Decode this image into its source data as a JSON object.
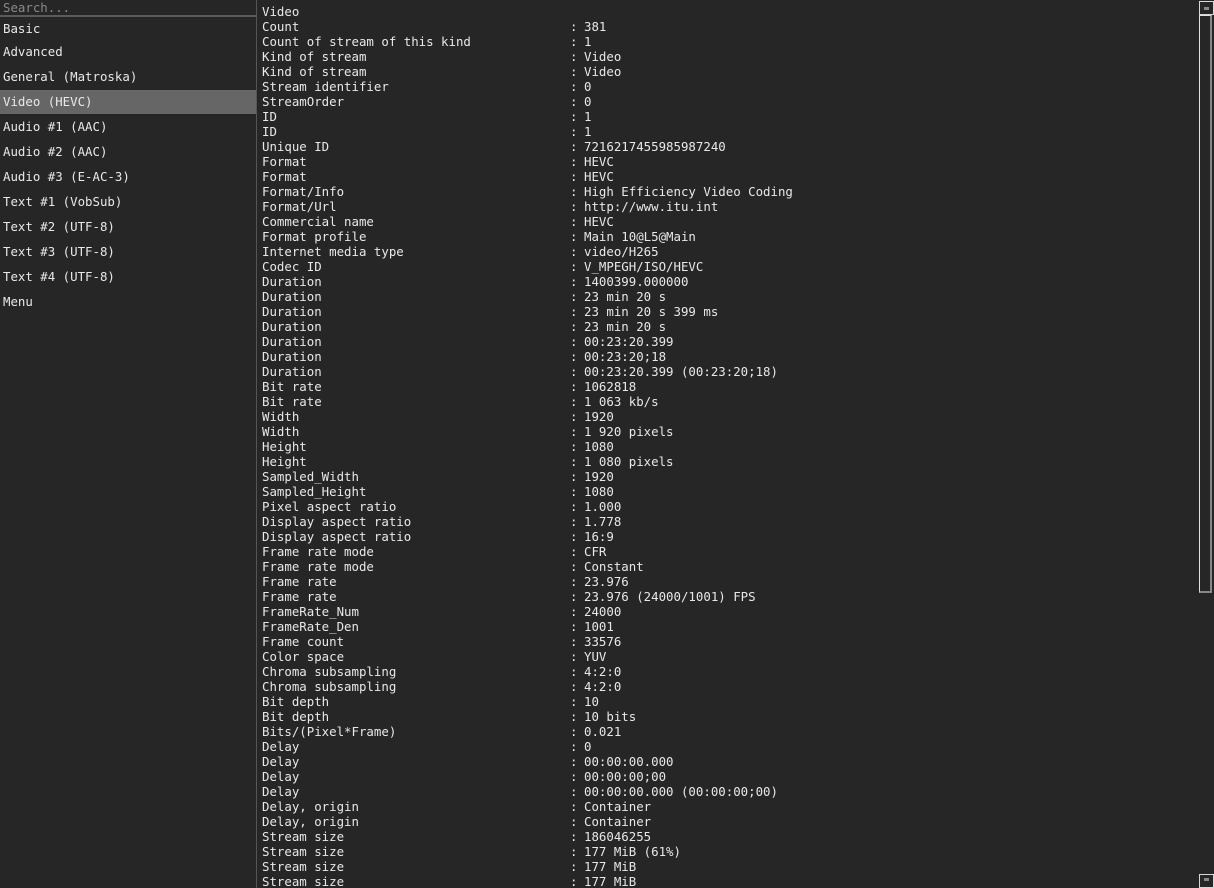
{
  "sidebar": {
    "search_placeholder": "Search...",
    "items": [
      {
        "label": "Basic",
        "selected": false
      },
      {
        "label": "Advanced",
        "selected": false
      },
      {
        "label": "General (Matroska)",
        "selected": false
      },
      {
        "label": "Video (HEVC)",
        "selected": true
      },
      {
        "label": "Audio #1 (AAC)",
        "selected": false
      },
      {
        "label": "Audio #2 (AAC)",
        "selected": false
      },
      {
        "label": "Audio #3 (E-AC-3)",
        "selected": false
      },
      {
        "label": "Text #1 (VobSub)",
        "selected": false
      },
      {
        "label": "Text #2 (UTF-8)",
        "selected": false
      },
      {
        "label": "Text #3 (UTF-8)",
        "selected": false
      },
      {
        "label": "Text #4 (UTF-8)",
        "selected": false
      },
      {
        "label": "Menu",
        "selected": false
      }
    ]
  },
  "main": {
    "section_title": "Video",
    "separator": ":",
    "rows": [
      {
        "label": "Count",
        "value": "381"
      },
      {
        "label": "Count of stream of this kind",
        "value": "1"
      },
      {
        "label": "Kind of stream",
        "value": "Video"
      },
      {
        "label": "Kind of stream",
        "value": "Video"
      },
      {
        "label": "Stream identifier",
        "value": "0"
      },
      {
        "label": "StreamOrder",
        "value": "0"
      },
      {
        "label": "ID",
        "value": "1"
      },
      {
        "label": "ID",
        "value": "1"
      },
      {
        "label": "Unique ID",
        "value": "7216217455985987240"
      },
      {
        "label": "Format",
        "value": "HEVC"
      },
      {
        "label": "Format",
        "value": "HEVC"
      },
      {
        "label": "Format/Info",
        "value": "High Efficiency Video Coding"
      },
      {
        "label": "Format/Url",
        "value": "http://www.itu.int"
      },
      {
        "label": "Commercial name",
        "value": "HEVC"
      },
      {
        "label": "Format profile",
        "value": "Main 10@L5@Main"
      },
      {
        "label": "Internet media type",
        "value": "video/H265"
      },
      {
        "label": "Codec ID",
        "value": "V_MPEGH/ISO/HEVC"
      },
      {
        "label": "Duration",
        "value": "1400399.000000"
      },
      {
        "label": "Duration",
        "value": "23 min 20 s"
      },
      {
        "label": "Duration",
        "value": "23 min 20 s 399 ms"
      },
      {
        "label": "Duration",
        "value": "23 min 20 s"
      },
      {
        "label": "Duration",
        "value": "00:23:20.399"
      },
      {
        "label": "Duration",
        "value": "00:23:20;18"
      },
      {
        "label": "Duration",
        "value": "00:23:20.399 (00:23:20;18)"
      },
      {
        "label": "Bit rate",
        "value": "1062818"
      },
      {
        "label": "Bit rate",
        "value": "1 063 kb/s"
      },
      {
        "label": "Width",
        "value": "1920"
      },
      {
        "label": "Width",
        "value": "1 920 pixels"
      },
      {
        "label": "Height",
        "value": "1080"
      },
      {
        "label": "Height",
        "value": "1 080 pixels"
      },
      {
        "label": "Sampled_Width",
        "value": "1920"
      },
      {
        "label": "Sampled_Height",
        "value": "1080"
      },
      {
        "label": "Pixel aspect ratio",
        "value": "1.000"
      },
      {
        "label": "Display aspect ratio",
        "value": "1.778"
      },
      {
        "label": "Display aspect ratio",
        "value": "16:9"
      },
      {
        "label": "Frame rate mode",
        "value": "CFR"
      },
      {
        "label": "Frame rate mode",
        "value": "Constant"
      },
      {
        "label": "Frame rate",
        "value": "23.976"
      },
      {
        "label": "Frame rate",
        "value": "23.976 (24000/1001) FPS"
      },
      {
        "label": "FrameRate_Num",
        "value": "24000"
      },
      {
        "label": "FrameRate_Den",
        "value": "1001"
      },
      {
        "label": "Frame count",
        "value": "33576"
      },
      {
        "label": "Color space",
        "value": "YUV"
      },
      {
        "label": "Chroma subsampling",
        "value": "4:2:0"
      },
      {
        "label": "Chroma subsampling",
        "value": "4:2:0"
      },
      {
        "label": "Bit depth",
        "value": "10"
      },
      {
        "label": "Bit depth",
        "value": "10 bits"
      },
      {
        "label": "Bits/(Pixel*Frame)",
        "value": "0.021"
      },
      {
        "label": "Delay",
        "value": "0"
      },
      {
        "label": "Delay",
        "value": "00:00:00.000"
      },
      {
        "label": "Delay",
        "value": "00:00:00;00"
      },
      {
        "label": "Delay",
        "value": "00:00:00.000 (00:00:00;00)"
      },
      {
        "label": "Delay, origin",
        "value": "Container"
      },
      {
        "label": "Delay, origin",
        "value": "Container"
      },
      {
        "label": "Stream size",
        "value": "186046255"
      },
      {
        "label": "Stream size",
        "value": "177 MiB (61%)"
      },
      {
        "label": "Stream size",
        "value": "177 MiB"
      },
      {
        "label": "Stream size",
        "value": "177 MiB"
      }
    ]
  },
  "scrollbar": {
    "up_icon": "arrow-up-icon",
    "down_icon": "arrow-down-icon",
    "visible_fraction": 0.66,
    "position_fraction": 0.0
  }
}
